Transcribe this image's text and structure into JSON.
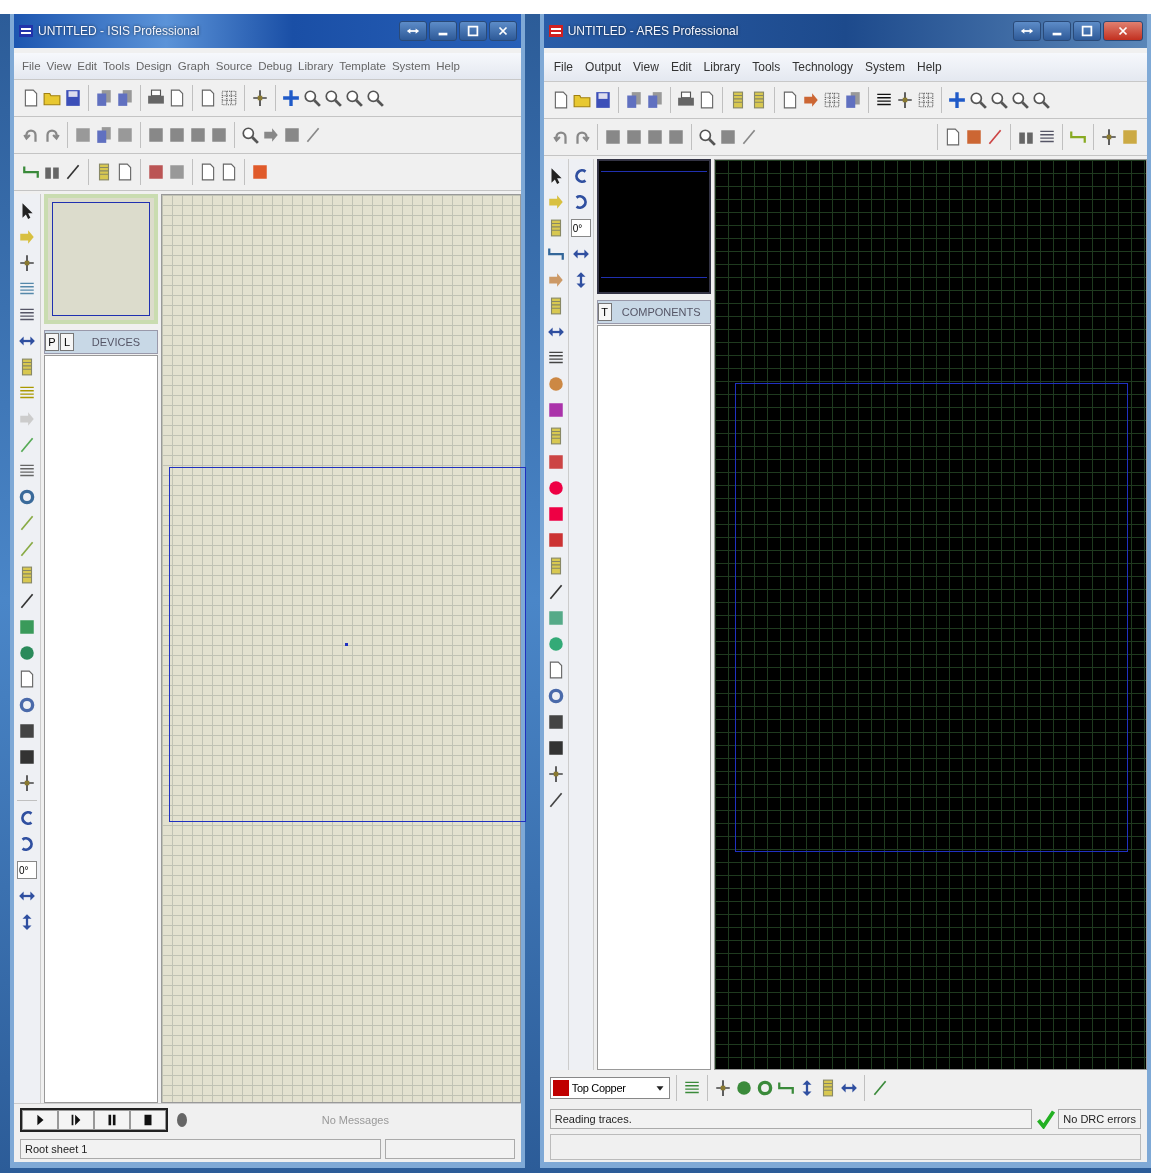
{
  "isis_window": {
    "title": "UNTITLED - ISIS Professional",
    "menu": [
      "File",
      "View",
      "Edit",
      "Tools",
      "Design",
      "Graph",
      "Source",
      "Debug",
      "Library",
      "Template",
      "System",
      "Help"
    ],
    "selector_buttons": [
      "P",
      "L"
    ],
    "selector_title": "DEVICES",
    "rotation_angle": "0°",
    "message": "No Messages",
    "status_bar": "Root sheet 1"
  },
  "ares_window": {
    "title": "UNTITLED - ARES Professional",
    "menu": [
      "File",
      "Output",
      "View",
      "Edit",
      "Library",
      "Tools",
      "Technology",
      "System",
      "Help"
    ],
    "selector_buttons": [
      "T"
    ],
    "selector_title": "COMPONENTS",
    "rotation_angle": "0°",
    "layer": "Top Copper",
    "status_bar": "Reading traces.",
    "drc_status": "No DRC errors"
  }
}
